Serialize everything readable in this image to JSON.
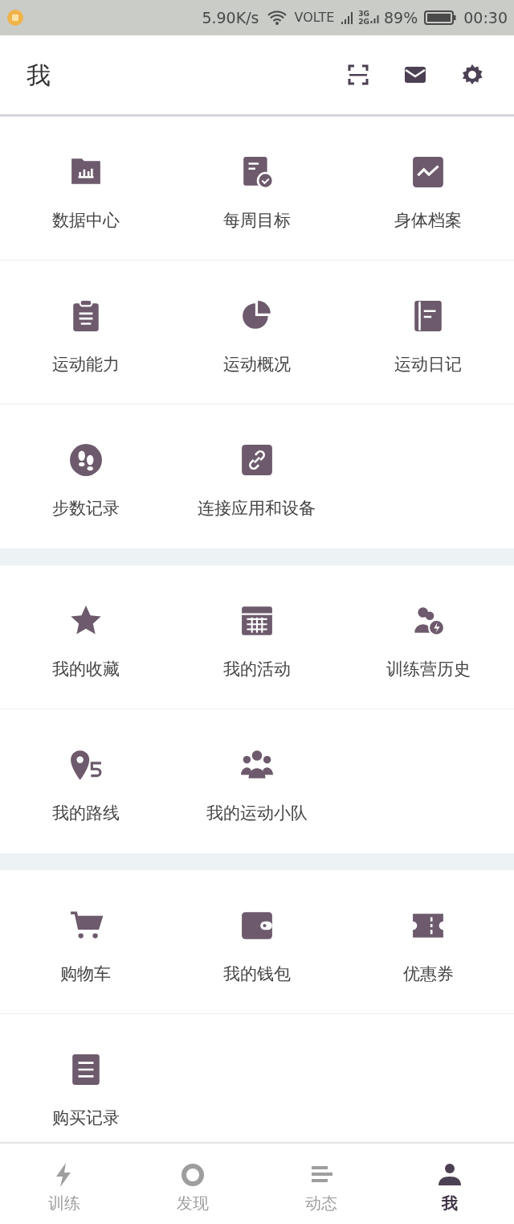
{
  "status_bar": {
    "speed": "5.90K/s",
    "network": "VOLTE",
    "sim2_top": "3G",
    "sim2_bottom": "2G",
    "battery": "89%",
    "time": "00:30"
  },
  "header": {
    "title": "我"
  },
  "sections": [
    {
      "items": [
        {
          "label": "数据中心"
        },
        {
          "label": "每周目标"
        },
        {
          "label": "身体档案"
        },
        {
          "label": "运动能力"
        },
        {
          "label": "运动概况"
        },
        {
          "label": "运动日记"
        },
        {
          "label": "步数记录"
        },
        {
          "label": "连接应用和设备"
        }
      ]
    },
    {
      "items": [
        {
          "label": "我的收藏"
        },
        {
          "label": "我的活动"
        },
        {
          "label": "训练营历史"
        },
        {
          "label": "我的路线"
        },
        {
          "label": "我的运动小队"
        }
      ]
    },
    {
      "items": [
        {
          "label": "购物车"
        },
        {
          "label": "我的钱包"
        },
        {
          "label": "优惠券"
        },
        {
          "label": "购买记录"
        }
      ]
    }
  ],
  "tabs": [
    {
      "label": "训练",
      "selected": false
    },
    {
      "label": "发现",
      "selected": false
    },
    {
      "label": "动态",
      "selected": false
    },
    {
      "label": "我",
      "selected": true
    }
  ]
}
